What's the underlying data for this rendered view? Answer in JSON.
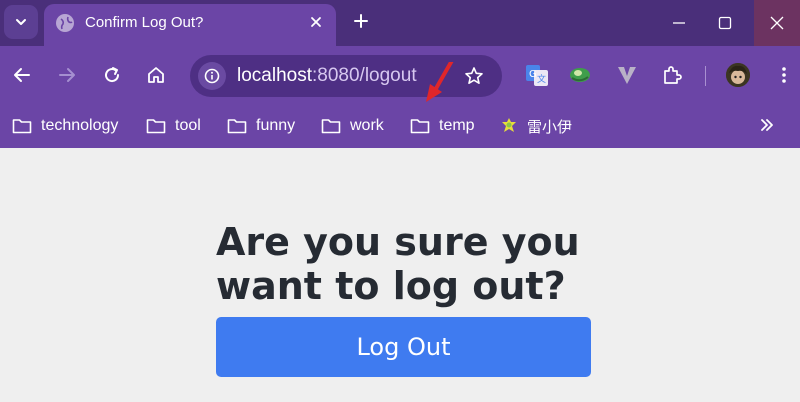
{
  "tab": {
    "title": "Confirm Log Out?"
  },
  "address_bar": {
    "host": "localhost",
    "path": ":8080/logout"
  },
  "bookmarks": [
    "technology",
    "tool",
    "funny",
    "work",
    "temp",
    "雷小伊"
  ],
  "page": {
    "heading_line1": "Are you sure you",
    "heading_line2": "want to log out?",
    "button_label": "Log Out"
  },
  "colors": {
    "tab_strip": "#4a2f7a",
    "toolbar": "#6b45a6",
    "button": "#3f7bf0",
    "page_bg": "#efefef",
    "annotation_arrow": "#e0262a"
  },
  "icons": [
    "tab-search-icon",
    "globe-icon",
    "close-icon",
    "plus-icon",
    "minimize-icon",
    "maximize-icon",
    "back-icon",
    "forward-icon",
    "reload-icon",
    "home-icon",
    "info-icon",
    "star-icon",
    "translate-icon",
    "extension-icon",
    "puzzle-icon",
    "folder-icon",
    "chevron-double-right-icon"
  ]
}
